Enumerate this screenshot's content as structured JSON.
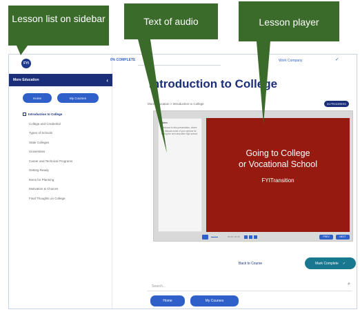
{
  "callouts": {
    "lesson_list": "Lesson list on sidebar",
    "text_of_audio": "Text of audio",
    "lesson_player": "Lesson player"
  },
  "app": {
    "logo_text": "FYI",
    "status": "0% COMPLETE",
    "company": "Work Company",
    "check_icon": "check-icon"
  },
  "sidebar": {
    "header": "More Education",
    "buttons": [
      "Home",
      "My Courses"
    ],
    "active_item": "Introduction to College",
    "items": [
      "College and Credential",
      "Types of Schools",
      "State Colleges",
      "Universities",
      "Career and Technical Programs",
      "Getting Ready",
      "Items for Planning",
      "Motivation & Choices",
      "Final Thoughts on College"
    ]
  },
  "main": {
    "title": "Introduction to College",
    "breadcrumb": "More Education > Introduction to College",
    "progress_badge": "IN PROGRESS",
    "notes": {
      "heading": "Notes",
      "text": "Welcome to this presentation, where we discuss some of your options for taking the next step after high school."
    },
    "slide": {
      "line1": "Going to College",
      "line2": "or Vocational School",
      "line3": "FYITransition"
    },
    "controls": {
      "time": "00:00 / 02:30",
      "prev": "PREV",
      "next": "NEXT"
    },
    "back_to_course": "Back to Course",
    "mark_complete": "Mark Complete",
    "search_placeholder": "Search...",
    "footer_buttons": [
      "Home",
      "My Courses"
    ]
  },
  "colors": {
    "navy": "#1a2e7a",
    "blue": "#2f5fc8",
    "slide_red": "#961a10",
    "teal": "#18788f",
    "callout_green": "#3a6b2a"
  }
}
